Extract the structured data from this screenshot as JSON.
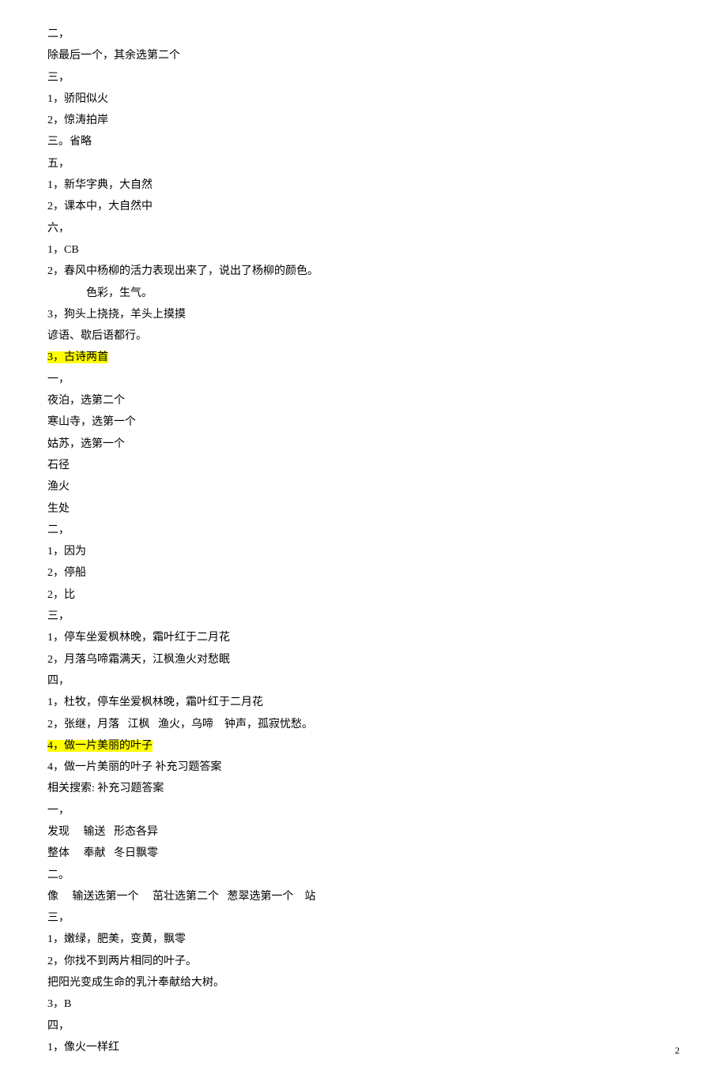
{
  "lines": [
    {
      "text": "二，",
      "hl": false,
      "indent": 0
    },
    {
      "text": "除最后一个，其余选第二个",
      "hl": false,
      "indent": 0
    },
    {
      "text": "三，",
      "hl": false,
      "indent": 0
    },
    {
      "text": "1，骄阳似火",
      "hl": false,
      "indent": 0
    },
    {
      "text": "2，惊涛拍岸",
      "hl": false,
      "indent": 0
    },
    {
      "text": "三。省略",
      "hl": false,
      "indent": 0
    },
    {
      "text": "五，",
      "hl": false,
      "indent": 0
    },
    {
      "text": "1，新华字典，大自然",
      "hl": false,
      "indent": 0
    },
    {
      "text": "2，课本中，大自然中",
      "hl": false,
      "indent": 0
    },
    {
      "text": "六，",
      "hl": false,
      "indent": 0
    },
    {
      "text": "1，CB",
      "hl": false,
      "indent": 0
    },
    {
      "text": "2，春风中杨柳的活力表现出来了，说出了杨柳的颜色。",
      "hl": false,
      "indent": 0
    },
    {
      "text": "色彩，生气。",
      "hl": false,
      "indent": 1
    },
    {
      "text": "3，狗头上挠挠，羊头上摸摸",
      "hl": false,
      "indent": 0
    },
    {
      "text": "谚语、歇后语都行。",
      "hl": false,
      "indent": 0
    },
    {
      "text": "3，古诗两首",
      "hl": true,
      "indent": 0
    },
    {
      "text": "一，",
      "hl": false,
      "indent": 0
    },
    {
      "text": "夜泊，选第二个",
      "hl": false,
      "indent": 0
    },
    {
      "text": "寒山寺，选第一个",
      "hl": false,
      "indent": 0
    },
    {
      "text": "姑苏，选第一个",
      "hl": false,
      "indent": 0
    },
    {
      "text": "石径",
      "hl": false,
      "indent": 0
    },
    {
      "text": "渔火",
      "hl": false,
      "indent": 0
    },
    {
      "text": "生处",
      "hl": false,
      "indent": 0
    },
    {
      "text": "二，",
      "hl": false,
      "indent": 0
    },
    {
      "text": "1，因为",
      "hl": false,
      "indent": 0
    },
    {
      "text": "2，停船",
      "hl": false,
      "indent": 0
    },
    {
      "text": "2，比",
      "hl": false,
      "indent": 0
    },
    {
      "text": "三，",
      "hl": false,
      "indent": 0
    },
    {
      "text": "1，停车坐爱枫林晚，霜叶红于二月花",
      "hl": false,
      "indent": 0
    },
    {
      "text": "2，月落乌啼霜满天，江枫渔火对愁眠",
      "hl": false,
      "indent": 0
    },
    {
      "text": "四，",
      "hl": false,
      "indent": 0
    },
    {
      "text": "1，杜牧，停车坐爱枫林晚，霜叶红于二月花",
      "hl": false,
      "indent": 0
    },
    {
      "text": "2，张继，月落   江枫   渔火，乌啼    钟声，孤寂忧愁。",
      "hl": false,
      "indent": 0
    },
    {
      "text": "4，做一片美丽的叶子",
      "hl": true,
      "indent": 0
    },
    {
      "text": "4，做一片美丽的叶子 补充习题答案",
      "hl": false,
      "indent": 0
    },
    {
      "text": "相关搜索: 补充习题答案",
      "hl": false,
      "indent": 0
    },
    {
      "text": "一，",
      "hl": false,
      "indent": 0
    },
    {
      "text": "发现     输送   形态各异",
      "hl": false,
      "indent": 0
    },
    {
      "text": "整体     奉献   冬日飘零",
      "hl": false,
      "indent": 0
    },
    {
      "text": "二。",
      "hl": false,
      "indent": 0
    },
    {
      "text": "像     输送选第一个     茁壮选第二个   葱翠选第一个    站",
      "hl": false,
      "indent": 0
    },
    {
      "text": "三，",
      "hl": false,
      "indent": 0
    },
    {
      "text": "1，嫩绿，肥美，变黄，飘零",
      "hl": false,
      "indent": 0
    },
    {
      "text": "2，你找不到两片相同的叶子。",
      "hl": false,
      "indent": 0
    },
    {
      "text": "把阳光变成生命的乳汁奉献给大树。",
      "hl": false,
      "indent": 0
    },
    {
      "text": "3，B",
      "hl": false,
      "indent": 0
    },
    {
      "text": "四，",
      "hl": false,
      "indent": 0
    },
    {
      "text": "1，像火一样红",
      "hl": false,
      "indent": 0
    }
  ],
  "page_number": "2"
}
